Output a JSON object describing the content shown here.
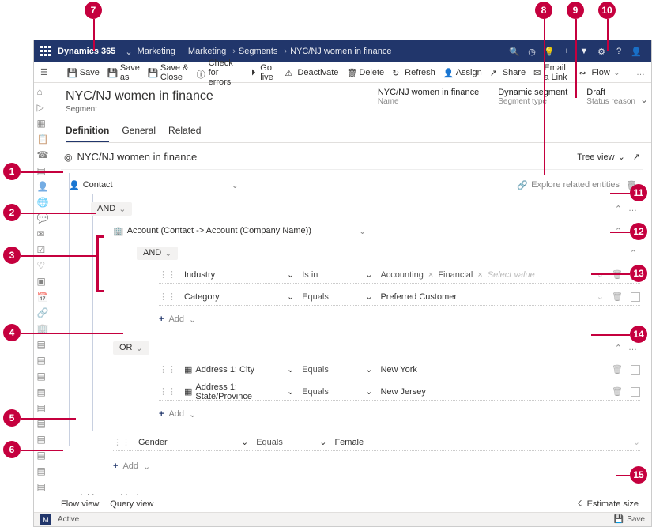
{
  "nav": {
    "brand": "Dynamics 365",
    "app": "Marketing",
    "crumbs": [
      "Marketing",
      "Segments",
      "NYC/NJ women in finance"
    ]
  },
  "commands": {
    "save": "Save",
    "saveAs": "Save as",
    "saveClose": "Save & Close",
    "check": "Check for errors",
    "golive": "Go live",
    "deactivate": "Deactivate",
    "delete": "Delete",
    "refresh": "Refresh",
    "assign": "Assign",
    "share": "Share",
    "emailLink": "Email a Link",
    "flow": "Flow"
  },
  "record": {
    "title": "NYC/NJ women in finance",
    "entity": "Segment",
    "fields": {
      "name": {
        "label": "Name",
        "value": "NYC/NJ women in finance"
      },
      "type": {
        "label": "Segment type",
        "value": "Dynamic segment"
      },
      "status": {
        "label": "Status reason",
        "value": "Draft"
      }
    }
  },
  "tabs": {
    "definition": "Definition",
    "general": "General",
    "related": "Related"
  },
  "designer": {
    "title": "NYC/NJ women in finance",
    "treeView": "Tree view",
    "exploreRelated": "Explore related entities",
    "contact": "Contact",
    "and": "AND",
    "or": "OR",
    "account": "Account (Contact -> Account (Company Name))",
    "fields": {
      "industry": "Industry",
      "category": "Category",
      "addrCity": "Address 1: City",
      "addrState": "Address 1: State/Province",
      "gender": "Gender"
    },
    "ops": {
      "isin": "Is in",
      "equals": "Equals"
    },
    "values": {
      "accounting": "Accounting",
      "financial": "Financial",
      "selectValue": "Select value",
      "preferred": "Preferred Customer",
      "newyork": "New York",
      "newjersey": "New Jersey",
      "female": "Female"
    },
    "add": "Add",
    "addQueryBlock": "Add query block",
    "flowView": "Flow view",
    "queryView": "Query view",
    "estimate": "Estimate size"
  },
  "status": {
    "badge": "M",
    "state": "Active",
    "save": "Save"
  },
  "callouts": {
    "1": "1",
    "2": "2",
    "3": "3",
    "4": "4",
    "5": "5",
    "6": "6",
    "7": "7",
    "8": "8",
    "9": "9",
    "10": "10",
    "11": "11",
    "12": "12",
    "13": "13",
    "14": "14",
    "15": "15"
  }
}
